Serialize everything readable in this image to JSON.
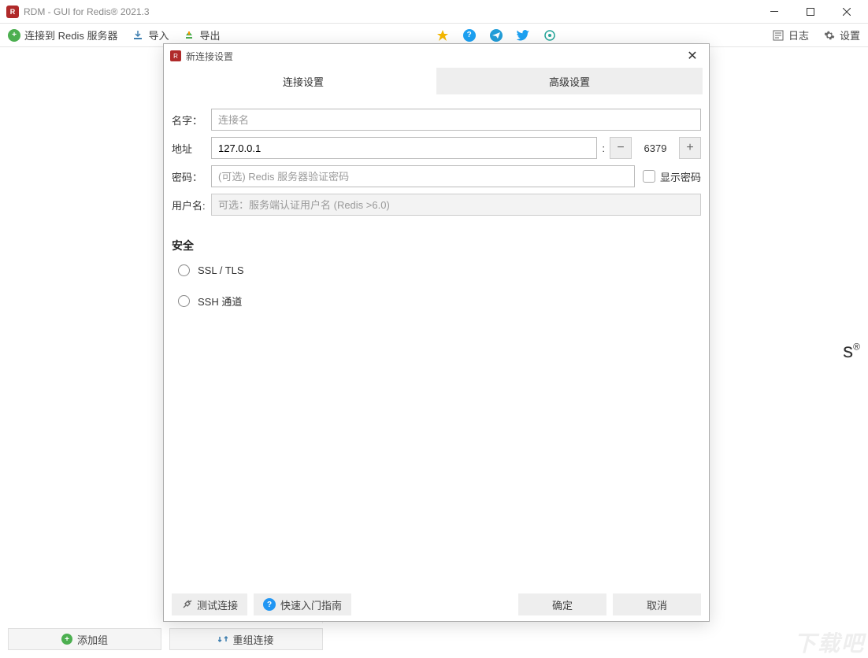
{
  "window": {
    "title": "RDM - GUI for Redis® 2021.3"
  },
  "toolbar": {
    "connect": "连接到 Redis 服务器",
    "import": "导入",
    "export": "导出",
    "logs": "日志",
    "settings": "设置"
  },
  "bottombar": {
    "add_group": "添加组",
    "reorder": "重组连接"
  },
  "dialog": {
    "title": "新连接设置",
    "tabs": {
      "connection": "连接设置",
      "advanced": "高级设置"
    },
    "labels": {
      "name": "名字：",
      "address": "地址",
      "password": "密码：",
      "username": "用户名:",
      "security": "安全",
      "ssl": "SSL / TLS",
      "ssh": "SSH 通道",
      "show_password": "显示密码"
    },
    "placeholders": {
      "name": "连接名",
      "password": "(可选) Redis 服务器验证密码",
      "username": "可选：服务端认证用户名 (Redis >6.0)"
    },
    "values": {
      "address": "127.0.0.1",
      "port": "6379"
    },
    "footer": {
      "test": "测试连接",
      "guide": "快速入门指南",
      "ok": "确定",
      "cancel": "取消"
    }
  },
  "background": {
    "s": "s"
  },
  "watermark": "下载吧"
}
